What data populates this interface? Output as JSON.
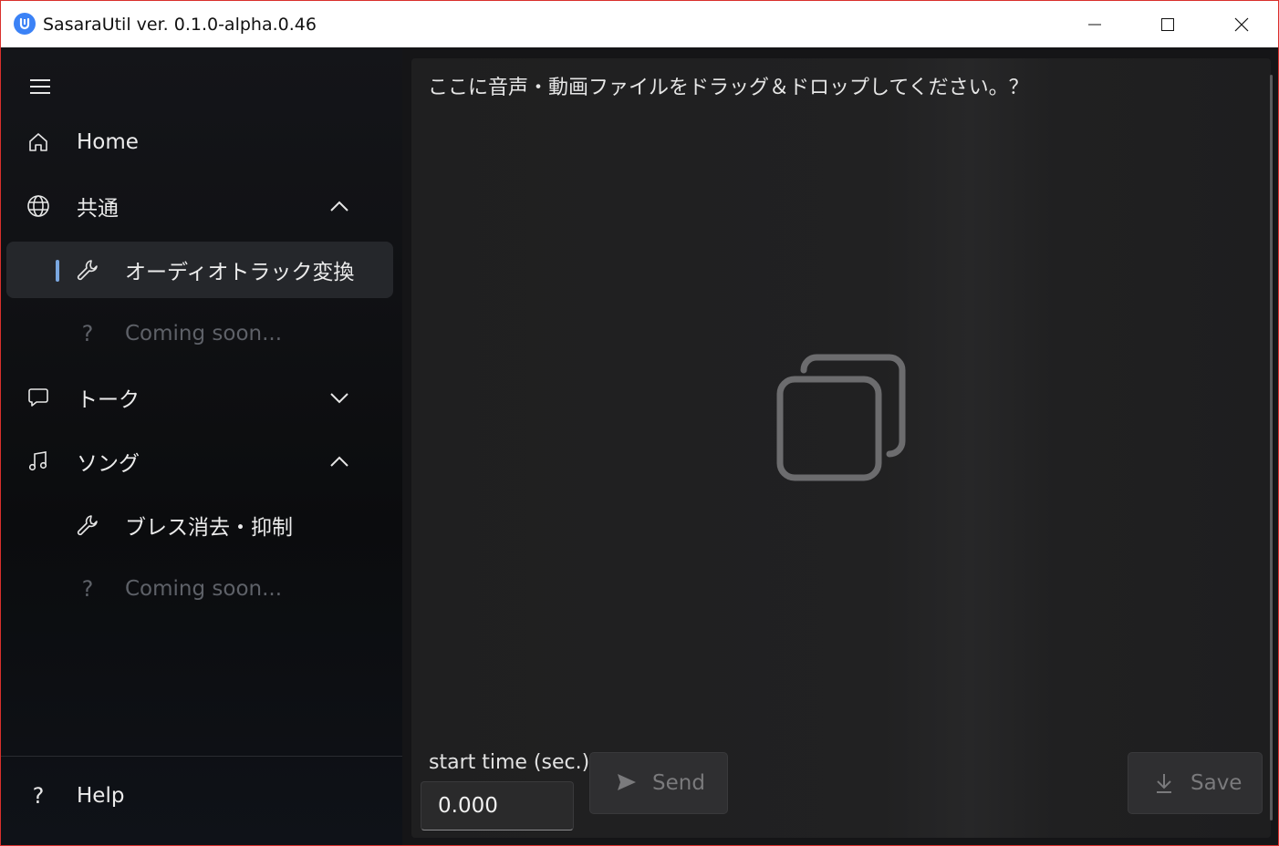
{
  "window": {
    "title": "SasaraUtil ver. 0.1.0-alpha.0.46"
  },
  "sidebar": {
    "items": [
      {
        "label": "Home",
        "icon": "home-icon"
      },
      {
        "label": "共通",
        "icon": "globe-icon",
        "expanded": true
      },
      {
        "label": "オーディオトラック変換",
        "icon": "wrench-icon",
        "selected": true
      },
      {
        "label": "Coming soon...",
        "icon": "question-icon",
        "disabled": true
      },
      {
        "label": "トーク",
        "icon": "chat-icon",
        "expanded": false
      },
      {
        "label": "ソング",
        "icon": "music-note-icon",
        "expanded": true
      },
      {
        "label": "ブレス消去・抑制",
        "icon": "wrench-icon"
      },
      {
        "label": "Coming soon...",
        "icon": "question-icon",
        "disabled": true
      }
    ],
    "footer": {
      "label": "Help",
      "icon": "question-icon"
    }
  },
  "main": {
    "drop_text": "ここに音声・動画ファイルをドラッグ＆ドロップしてください。？",
    "start_time_label": "start time (sec.):",
    "start_time_value": "0.000",
    "send_label": "Send",
    "save_label": "Save"
  },
  "colors": {
    "accent": "#7aa7e0",
    "app_icon": "#3b82f6",
    "selected_bg": "#25272b",
    "disabled_text": "#5e6168"
  }
}
